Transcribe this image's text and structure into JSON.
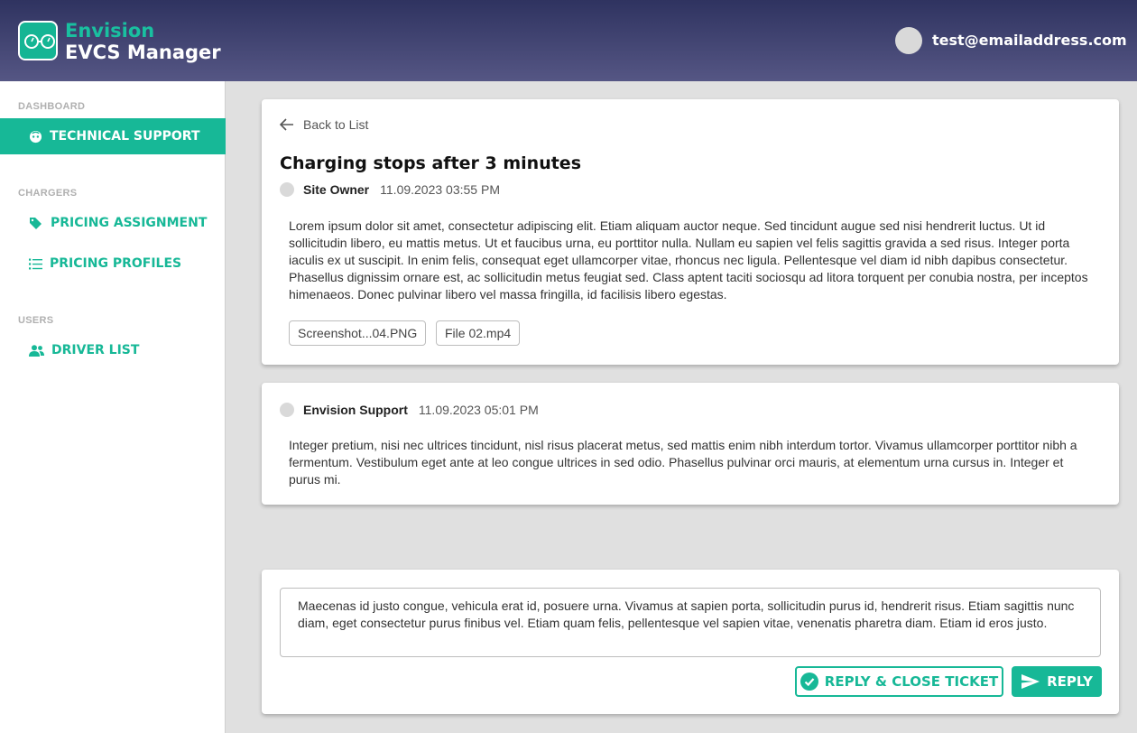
{
  "header": {
    "brand_line1": "Envision",
    "brand_line2": "EVCS Manager",
    "user_email": "test@emailaddress.com"
  },
  "sidebar": {
    "sections": [
      {
        "label": "DASHBOARD"
      },
      {
        "label": "CHARGERS"
      },
      {
        "label": "USERS"
      }
    ],
    "items": [
      {
        "label": "TECHNICAL SUPPORT",
        "icon": "support-icon",
        "active": true
      },
      {
        "label": "PRICING ASSIGNMENT",
        "icon": "tag-icon"
      },
      {
        "label": "PRICING PROFILES",
        "icon": "list-icon"
      },
      {
        "label": "DRIVER LIST",
        "icon": "people-icon"
      }
    ]
  },
  "ticket": {
    "back_label": "Back to List",
    "title": "Charging stops after 3 minutes",
    "author": "Site Owner",
    "date": "11.09.2023 03:55 PM",
    "body": "Lorem ipsum dolor sit amet, consectetur adipiscing elit. Etiam aliquam auctor neque. Sed tincidunt augue sed nisi hendrerit luctus. Ut id sollicitudin libero, eu mattis metus. Ut et faucibus urna, eu porttitor nulla. Nullam eu sapien vel felis sagittis gravida a sed risus. Integer porta iaculis ex ut suscipit. In enim felis, consequat eget ullamcorper vitae, rhoncus nec ligula. Pellentesque vel diam id nibh dapibus consectetur. Phasellus dignissim ornare est, ac sollicitudin metus feugiat sed. Class aptent taciti sociosqu ad litora torquent per conubia nostra, per inceptos himenaeos. Donec pulvinar libero vel massa fringilla, id facilisis libero egestas.",
    "attachments": [
      "Screenshot...04.PNG",
      "File 02.mp4"
    ]
  },
  "response": {
    "author": "Envision Support",
    "date": "11.09.2023 05:01 PM",
    "body": "Integer pretium, nisi nec ultrices tincidunt, nisl risus placerat metus, sed mattis enim nibh interdum tortor. Vivamus ullamcorper porttitor nibh a fermentum. Vestibulum eget ante at leo congue ultrices in sed odio. Phasellus pulvinar orci mauris, at elementum urna cursus in. Integer et purus mi."
  },
  "reply": {
    "text": "Maecenas id justo congue, vehicula erat id, posuere urna. Vivamus at sapien porta, sollicitudin purus id, hendrerit risus. Etiam sagittis nunc diam, eget consectetur purus finibus vel. Etiam quam felis, pellentesque vel sapien vitae, venenatis pharetra diam. Etiam id eros justo.",
    "close_label": "REPLY & CLOSE TICKET",
    "reply_label": "REPLY"
  },
  "colors": {
    "accent": "#17b897",
    "header_top": "#2f3360",
    "header_bottom": "#555684"
  }
}
